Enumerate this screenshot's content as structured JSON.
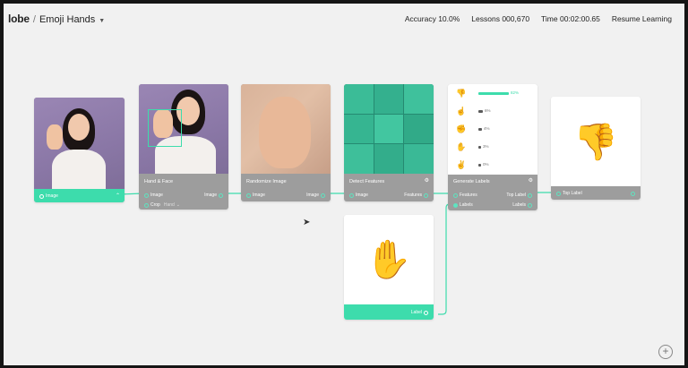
{
  "app": {
    "logo": "lobe",
    "separator": "/",
    "project": "Emoji Hands"
  },
  "stats": {
    "accuracy": "Accuracy 10.0%",
    "lessons": "Lessons 000,670",
    "time": "Time 00:02:00.65",
    "resume": "Resume Learning"
  },
  "nodes": {
    "image": {
      "label": "Image"
    },
    "hand_face": {
      "title": "Hand & Face",
      "in_label": "Image",
      "out_label": "Image",
      "crop_label": "Crop",
      "crop_value": "Hand"
    },
    "randomize": {
      "title": "Randomize Image",
      "in_label": "Image",
      "out_label": "Image"
    },
    "detect": {
      "title": "Detect Features",
      "in_label": "Image",
      "out_label": "Features"
    },
    "generate": {
      "title": "Generate Labels",
      "in1": "Features",
      "out1": "Top Label",
      "in2": "Labels",
      "out2": "Labels",
      "rows": [
        {
          "icon": "thumbs-down-icon",
          "glyph": "👎",
          "pct": "82%",
          "value": 0.82,
          "active": true
        },
        {
          "icon": "point-up-icon",
          "glyph": "☝",
          "pct": "6%",
          "value": 0.06,
          "active": false
        },
        {
          "icon": "fist-icon",
          "glyph": "✊",
          "pct": "4%",
          "value": 0.04,
          "active": false
        },
        {
          "icon": "open-hand-icon",
          "glyph": "✋",
          "pct": "3%",
          "value": 0.03,
          "active": false
        },
        {
          "icon": "peace-icon",
          "glyph": "✌",
          "pct": "0%",
          "value": 0.0,
          "active": false
        }
      ]
    },
    "top_label": {
      "label": "Top Label",
      "emoji": "👎"
    },
    "label": {
      "label": "Label",
      "emoji": "✋"
    }
  },
  "colors": {
    "accent": "#3ddcac",
    "node_footer": "#9d9d9d"
  }
}
